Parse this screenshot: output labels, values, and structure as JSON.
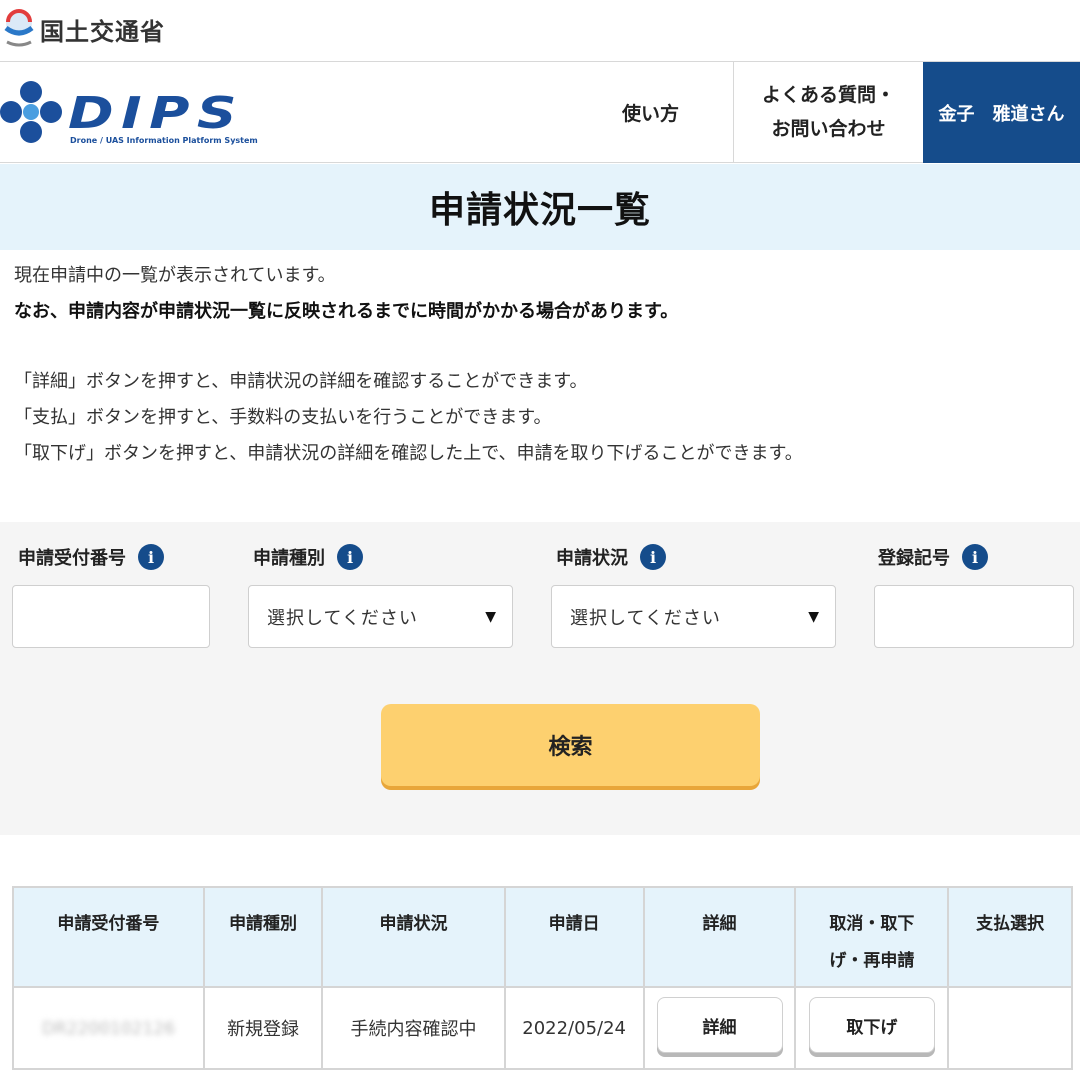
{
  "ministry": {
    "name": "国土交通省",
    "logo_icon": "mlit-logo-icon"
  },
  "header": {
    "logo_text": "DIPS",
    "logo_subtitle": "Drone / UAS Information Platform System",
    "nav_howto": "使い方",
    "nav_faq_line1": "よくある質問・",
    "nav_faq_line2": "お問い合わせ",
    "user_name": "金子　雅道さん",
    "brand_color": "#154c8b"
  },
  "page": {
    "title": "申請状況一覧"
  },
  "info": {
    "line1": "現在申請中の一覧が表示されています。",
    "line2": "なお、申請内容が申請状況一覧に反映されるまでに時間がかかる場合があります。",
    "line3": "「詳細」ボタンを押すと、申請状況の詳細を確認することができます。",
    "line4": "「支払」ボタンを押すと、手数料の支払いを行うことができます。",
    "line5": "「取下げ」ボタンを押すと、申請状況の詳細を確認した上で、申請を取り下げることができます。"
  },
  "search": {
    "label_receipt_no": "申請受付番号",
    "label_type": "申請種別",
    "label_status": "申請状況",
    "label_reg_no": "登録記号",
    "info_icon": "info-icon",
    "receipt_no_value": "",
    "reg_no_value": "",
    "type_selected": "選択してください",
    "status_selected": "選択してください",
    "search_button": "検索",
    "button_color": "#fdd06f"
  },
  "table": {
    "headers": {
      "receipt_no": "申請受付番号",
      "type": "申請種別",
      "status": "申請状況",
      "date": "申請日",
      "detail": "詳細",
      "cancel_line1": "取消・取下",
      "cancel_line2": "げ・再申請",
      "payment": "支払選択"
    },
    "rows": [
      {
        "receipt_no": "DR2200102126",
        "type": "新規登録",
        "status": "手続内容確認中",
        "date": "2022/05/24",
        "detail_button": "詳細",
        "withdraw_button": "取下げ",
        "payment": ""
      }
    ]
  }
}
